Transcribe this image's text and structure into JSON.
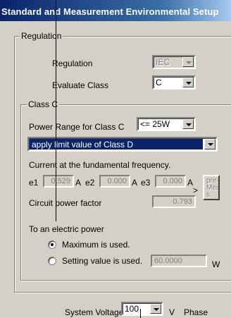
{
  "title": "Standard and Measurement Environmental Setup",
  "regulation_group": {
    "legend": "Regulation",
    "regulation_label": "Regulation",
    "regulation_value": "IEC",
    "evaluate_label": "Evaluate Class",
    "evaluate_value": "C"
  },
  "class_c_group": {
    "legend": "Class C",
    "power_range_label": "Power Range for Class C",
    "power_range_value": "<= 25W",
    "limit_option": "apply limit value of Class D",
    "current_label": "Current at the fundamental frequency.",
    "e1_label": "e1",
    "e1_value": "0.529",
    "e2_label": "e2",
    "e2_value": "0.000",
    "e3_label": "e3",
    "e3_value": "0.000",
    "unit_a": "A",
    "pre_measure_button": "pre-\nMea\ns.",
    "next_arrow": ">",
    "power_factor_label": "Circuit power factor",
    "power_factor_value": "0.793"
  },
  "electric_power": {
    "label": "To an electric power",
    "option_max": "Maximum is used.",
    "option_setting": "Setting value is used.",
    "setting_value": "60.0000",
    "unit_w": "W",
    "selected": "max"
  },
  "bottom": {
    "system_voltage_label": "System Voltage",
    "system_voltage_value": "100",
    "unit_v": "V",
    "phase_label": "Phase"
  }
}
